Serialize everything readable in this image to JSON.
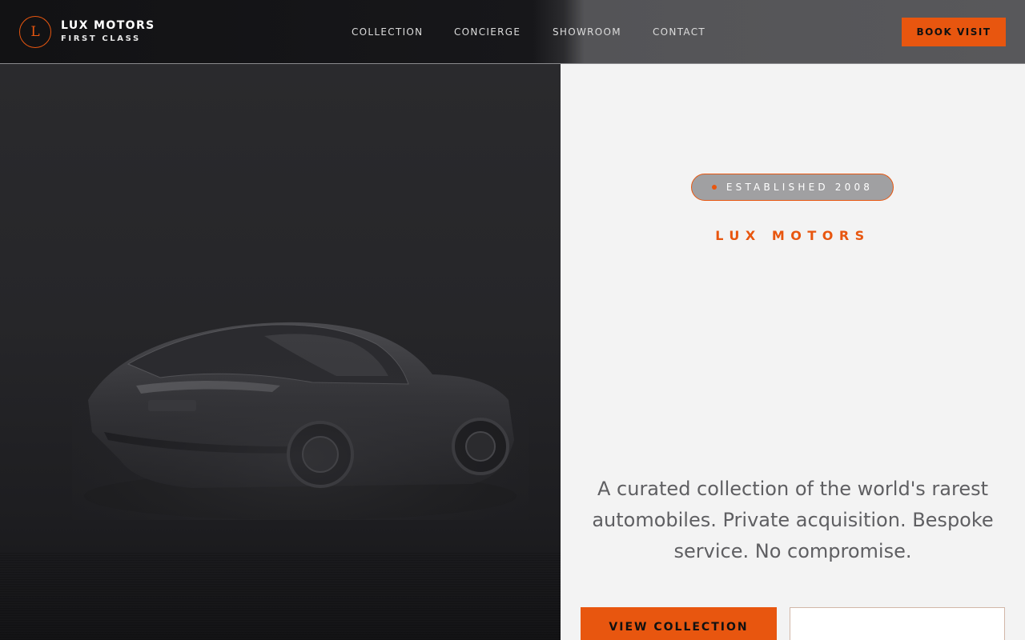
{
  "header": {
    "logo_letter": "L",
    "logo_title": "LUX MOTORS",
    "logo_subtitle": "FIRST CLASS",
    "nav": [
      {
        "label": "COLLECTION"
      },
      {
        "label": "CONCIERGE"
      },
      {
        "label": "SHOWROOM"
      },
      {
        "label": "CONTACT"
      }
    ],
    "cta_label": "BOOK VISIT"
  },
  "hero": {
    "badge_text": "ESTABLISHED 2008",
    "brand": "LUX MOTORS",
    "tagline": "A curated collection of the world's rarest automobiles. Private acquisition. Bespoke service. No compromise.",
    "primary_button": "VIEW COLLECTION",
    "secondary_button": ""
  },
  "colors": {
    "accent": "#e8560f",
    "dark": "#121214",
    "light": "#f3f3f3",
    "text_muted": "#5f5f62"
  },
  "icons": {
    "logo": "letter-monogram-icon",
    "badge_dot": "dot-icon",
    "hero_image": "sports-car-image"
  }
}
